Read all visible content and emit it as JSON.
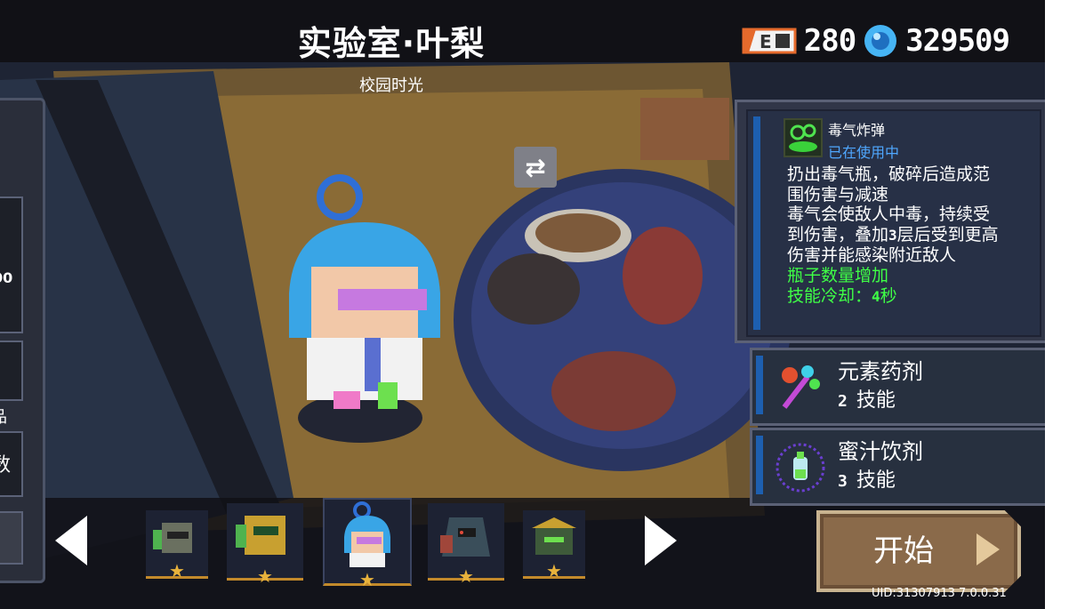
{
  "header": {
    "title": "实验室·叶梨",
    "subtitle": "校园时光"
  },
  "currency": {
    "energy_icon": "e-card-icon",
    "energy_value": "280",
    "gem_icon": "gem-icon",
    "gem_value": "329509"
  },
  "left_panel": {
    "partial_value": "00",
    "partial_char_1": "品",
    "partial_char_2": "数"
  },
  "skill": {
    "name": "毒气炸弹",
    "status": "已在使用中",
    "description_lines": [
      "扔出毒气瓶，破碎后造成范",
      "围伤害与减速",
      "毒气会使敌人中毒，持续受",
      "到伤害，叠加",
      "3",
      "层后受到更高",
      "伤害并能感染附近敌人"
    ],
    "bonus_1": "瓶子数量增加",
    "cooldown_label": "技能冷却：",
    "cooldown_value": "4",
    "cooldown_unit": "秒"
  },
  "weapons": [
    {
      "name": "元素药剂",
      "count": "2",
      "skill_label": "技能"
    },
    {
      "name": "蜜汁饮剂",
      "count": "3",
      "skill_label": "技能"
    }
  ],
  "start_button": {
    "label": "开始"
  },
  "uid": "UID:31307913 7.0.0.31",
  "colors": {
    "accent_blue": "#1d5fb0",
    "status_blue": "#4fa7ff",
    "bonus_green": "#3fff46",
    "star_gold": "#e8b23c",
    "start_brown": "#8a6a4a"
  }
}
